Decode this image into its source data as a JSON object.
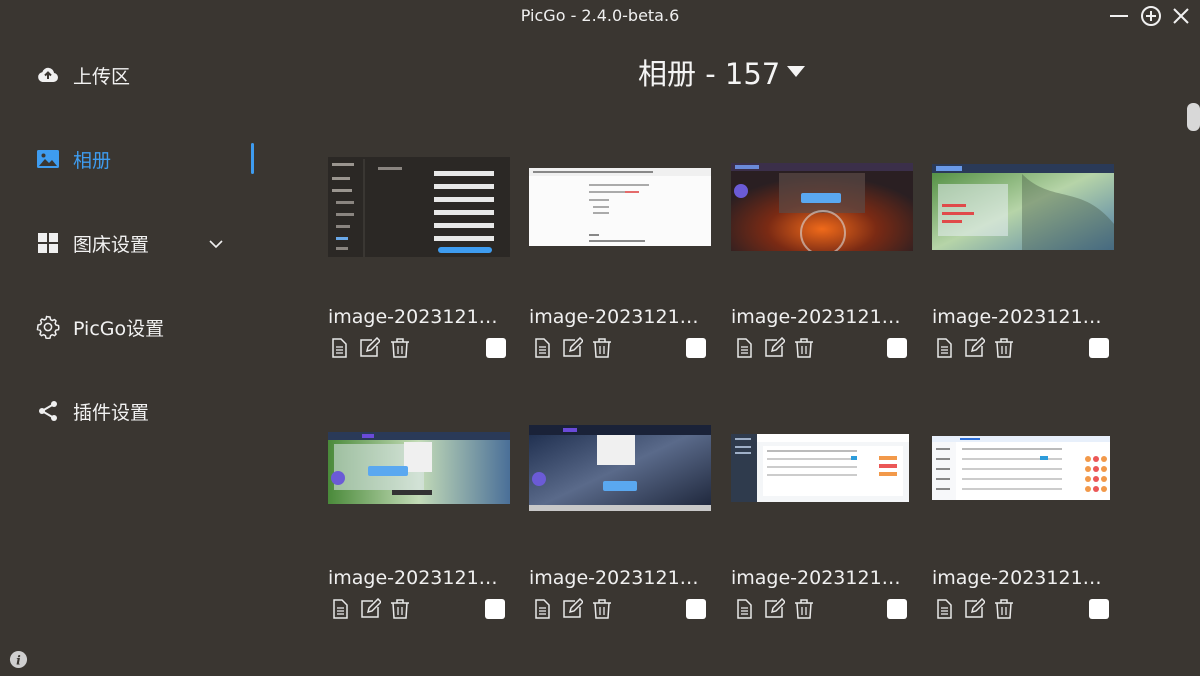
{
  "window": {
    "title": "PicGo - 2.4.0-beta.6"
  },
  "sidebar": {
    "items": [
      {
        "label": "上传区",
        "icon": "cloud-upload-icon"
      },
      {
        "label": "相册",
        "icon": "image-icon",
        "active": true
      },
      {
        "label": "图床设置",
        "icon": "grid-icon"
      },
      {
        "label": "PicGo设置",
        "icon": "gear-icon"
      },
      {
        "label": "插件设置",
        "icon": "share-icon"
      }
    ]
  },
  "album": {
    "title": "相册 - 157"
  },
  "gallery": {
    "items": [
      {
        "name": "image-2023121…"
      },
      {
        "name": "image-2023121…"
      },
      {
        "name": "image-2023121…"
      },
      {
        "name": "image-2023121…"
      },
      {
        "name": "image-2023121…"
      },
      {
        "name": "image-2023121…"
      },
      {
        "name": "image-2023121…"
      },
      {
        "name": "image-2023121…"
      }
    ]
  },
  "colors": {
    "accent": "#3e9cf0",
    "background": "#3a3631"
  }
}
